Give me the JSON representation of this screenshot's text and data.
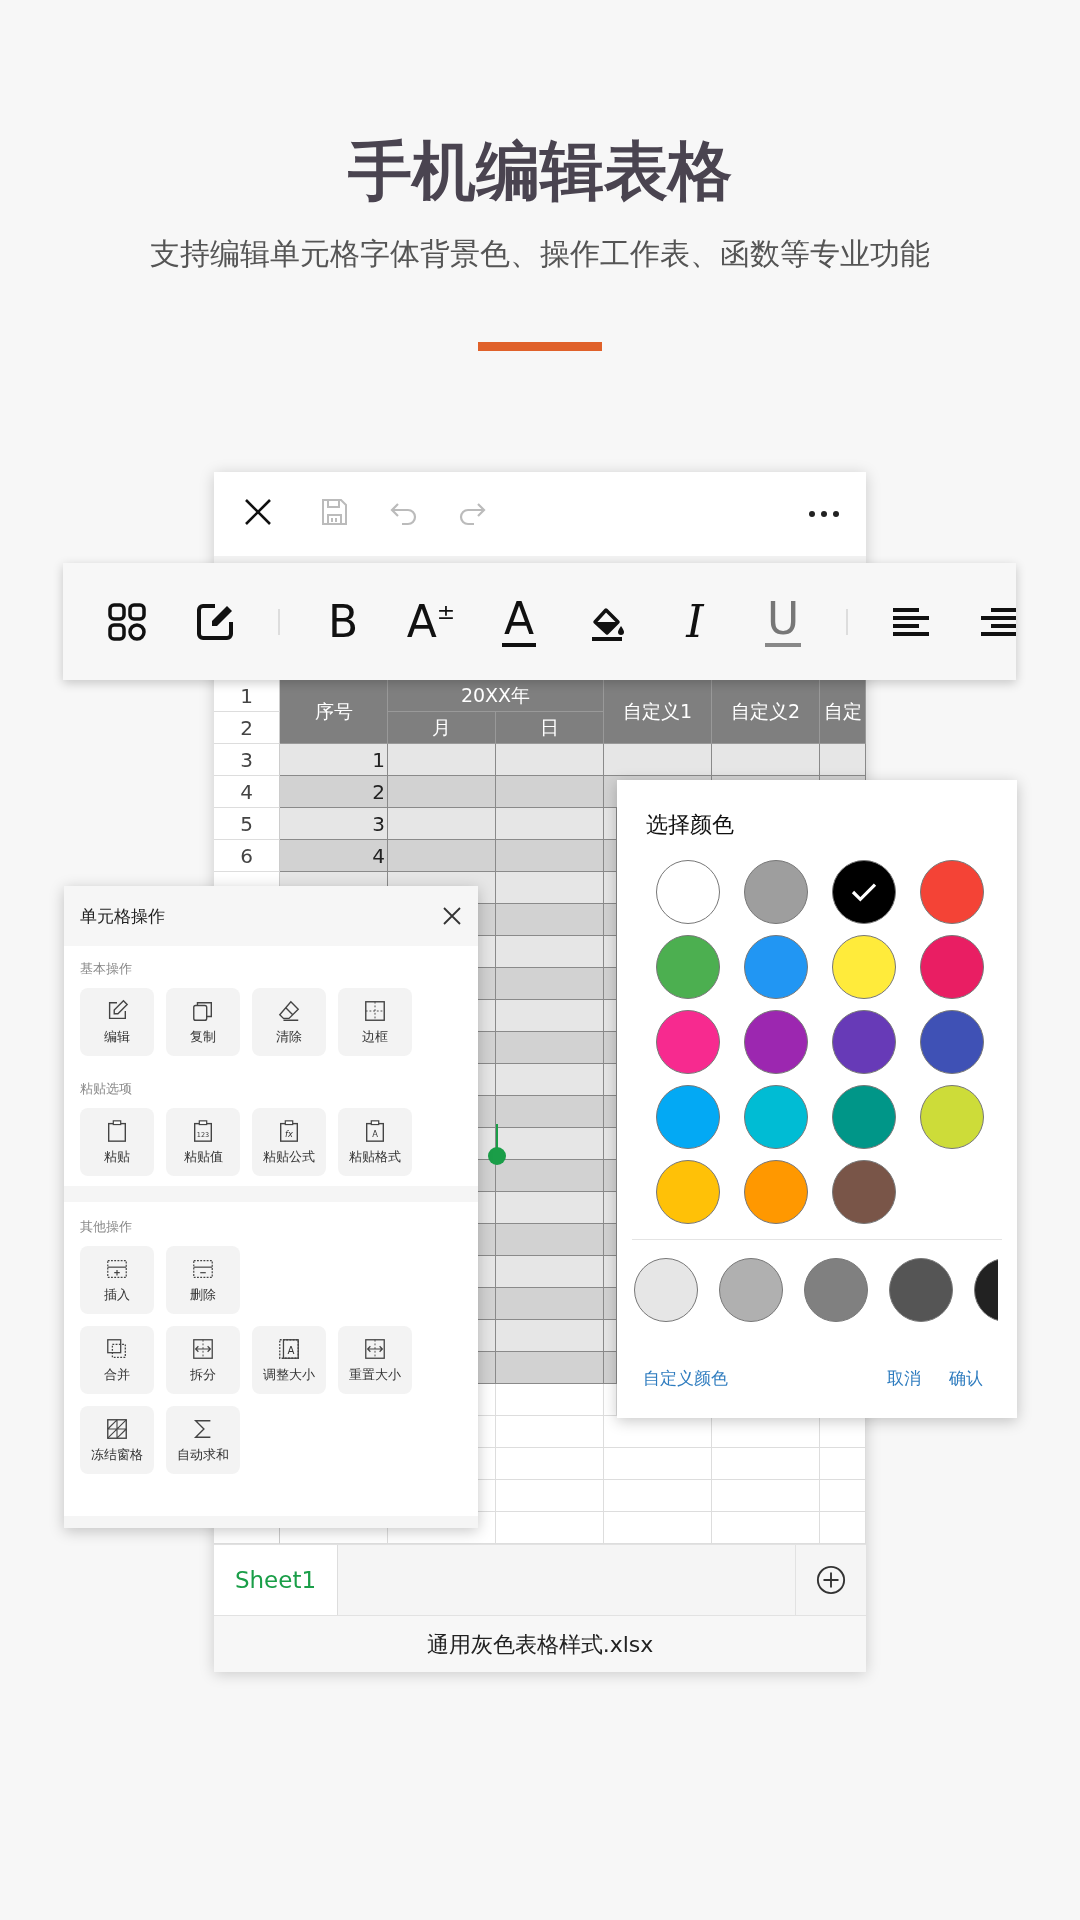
{
  "header": {
    "title": "手机编辑表格",
    "subtitle": "支持编辑单元格字体背景色、操作工作表、函数等专业功能"
  },
  "sheet_window": {
    "header_row_numbers": [
      "1",
      "2"
    ],
    "header": {
      "index": "序号",
      "group": "20XX年",
      "sub": [
        "月",
        "日"
      ],
      "custom": [
        "自定义1",
        "自定义2",
        "自定"
      ]
    },
    "rows": [
      {
        "number": "3",
        "index": "1"
      },
      {
        "number": "4",
        "index": "2"
      },
      {
        "number": "5",
        "index": "3"
      },
      {
        "number": "6",
        "index": "4"
      }
    ],
    "sheet_tabs": [
      {
        "label": "Sheet1",
        "selected": true
      }
    ],
    "file_name": "通用灰色表格样式.xlsx"
  },
  "format_toolbar": {
    "bold": "B",
    "font_size": "A",
    "font_size_sign": "±",
    "font_color": "A",
    "italic": "I",
    "underline": "U"
  },
  "cell_panel": {
    "title": "单元格操作",
    "sections": [
      {
        "title": "基本操作",
        "items": [
          {
            "label": "编辑"
          },
          {
            "label": "复制"
          },
          {
            "label": "清除"
          },
          {
            "label": "边框"
          }
        ]
      },
      {
        "title": "粘贴选项",
        "items": [
          {
            "label": "粘贴"
          },
          {
            "label": "粘贴值",
            "icon_text": "123"
          },
          {
            "label": "粘贴公式",
            "icon_text": "fx"
          },
          {
            "label": "粘贴格式",
            "icon_text": "A"
          }
        ]
      },
      {
        "title": "其他操作",
        "items": [
          {
            "label": "插入"
          },
          {
            "label": "删除"
          },
          {
            "label": "合并"
          },
          {
            "label": "拆分"
          },
          {
            "label": "调整大小",
            "icon_text": "A"
          },
          {
            "label": "重置大小"
          },
          {
            "label": "冻结窗格"
          },
          {
            "label": "自动求和"
          }
        ]
      }
    ]
  },
  "color_panel": {
    "title": "选择颜色",
    "colors": [
      {
        "color": "#ffffff",
        "selected": false
      },
      {
        "color": "#9e9e9e",
        "selected": false
      },
      {
        "color": "#000000",
        "selected": true
      },
      {
        "color": "#f44336",
        "selected": false
      },
      {
        "color": "#4caf50",
        "selected": false
      },
      {
        "color": "#2196f3",
        "selected": false
      },
      {
        "color": "#ffeb3b",
        "selected": false
      },
      {
        "color": "#e91e63",
        "selected": false
      },
      {
        "color": "#f72a8f",
        "selected": false
      },
      {
        "color": "#9c27b0",
        "selected": false
      },
      {
        "color": "#673ab7",
        "selected": false
      },
      {
        "color": "#3f51b5",
        "selected": false
      },
      {
        "color": "#03a9f4",
        "selected": false
      },
      {
        "color": "#00bcd4",
        "selected": false
      },
      {
        "color": "#009688",
        "selected": false
      },
      {
        "color": "#cddc39",
        "selected": false
      },
      {
        "color": "#ffc107",
        "selected": false
      },
      {
        "color": "#ff9800",
        "selected": false
      },
      {
        "color": "#795548",
        "selected": false
      }
    ],
    "grays": [
      {
        "color": "#e6e6e6",
        "selected": false
      },
      {
        "color": "#b0b0b0",
        "selected": false
      },
      {
        "color": "#808080",
        "selected": false
      },
      {
        "color": "#555555",
        "selected": false
      },
      {
        "color": "#222222",
        "selected": false
      }
    ],
    "custom_button": "自定义颜色",
    "cancel_button": "取消",
    "confirm_button": "确认"
  }
}
